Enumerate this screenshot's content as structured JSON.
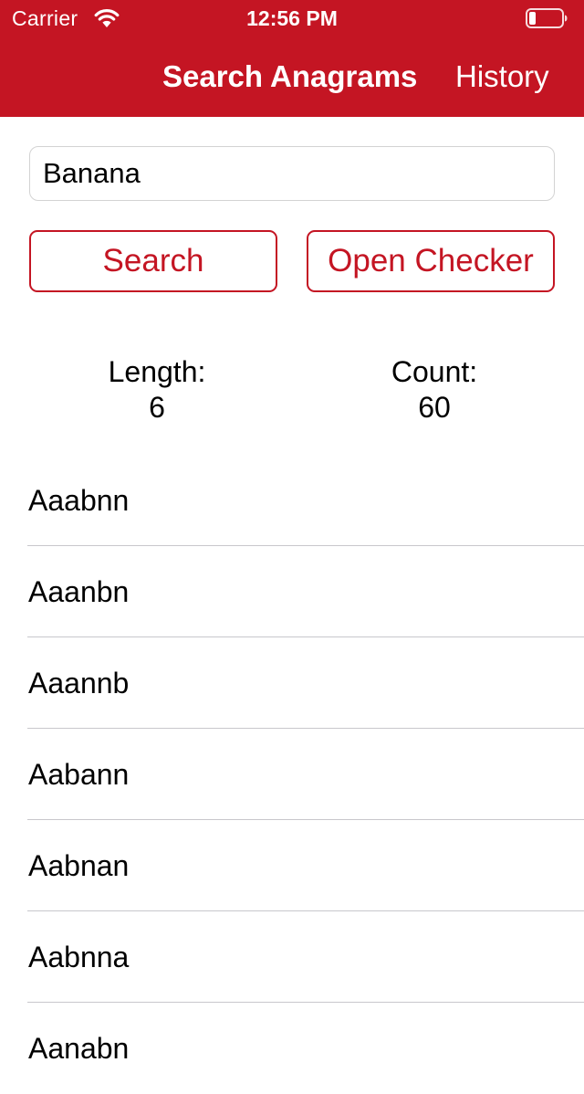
{
  "status_bar": {
    "carrier": "Carrier",
    "time": "12:56 PM",
    "wifi_icon": "wifi-icon",
    "battery_icon": "battery-low-icon"
  },
  "nav": {
    "title": "Search Anagrams",
    "history_label": "History"
  },
  "search": {
    "value": "Banana"
  },
  "buttons": {
    "search_label": "Search",
    "checker_label": "Open Checker"
  },
  "stats": {
    "length_label": "Length:",
    "length_value": "6",
    "count_label": "Count:",
    "count_value": "60"
  },
  "results": [
    "Aaabnn",
    "Aaanbn",
    "Aaannb",
    "Aabann",
    "Aabnan",
    "Aabnna",
    "Aanabn"
  ],
  "colors": {
    "accent": "#c41523",
    "separator": "#c8c7cc",
    "input_border": "#d3d3d3"
  }
}
